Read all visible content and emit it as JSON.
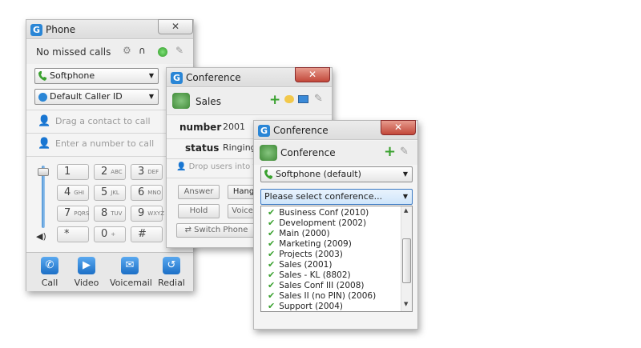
{
  "phone": {
    "title": "Phone",
    "close": "✕",
    "status": "No missed calls",
    "device": "Softphone",
    "caller_id": "Default Caller ID",
    "contact_placeholder": "Drag a contact to call",
    "number_placeholder": "Enter a number to call",
    "keys": [
      {
        "d": "1",
        "s": ""
      },
      {
        "d": "2",
        "s": "ABC"
      },
      {
        "d": "3",
        "s": "DEF"
      },
      {
        "d": "4",
        "s": "GHI"
      },
      {
        "d": "5",
        "s": "JKL"
      },
      {
        "d": "6",
        "s": "MNO"
      },
      {
        "d": "7",
        "s": "PQRS"
      },
      {
        "d": "8",
        "s": "TUV"
      },
      {
        "d": "9",
        "s": "WXYZ"
      },
      {
        "d": "*",
        "s": ""
      },
      {
        "d": "0",
        "s": "+"
      },
      {
        "d": "#",
        "s": ""
      }
    ],
    "volume": 0.85,
    "toolbar": [
      "Call",
      "Video",
      "Voicemail",
      "Redial"
    ]
  },
  "conf1": {
    "title": "Conference",
    "close": "✕",
    "name": "Sales",
    "number_label": "number",
    "number_value": "2001",
    "status_label": "status",
    "status_value": "Ringing (",
    "drop_placeholder": "Drop users into th",
    "buttons": {
      "answer": "Answer",
      "hangup": "Hang",
      "hold": "Hold",
      "voicemail": "Voicel",
      "switch": "Switch Phone"
    }
  },
  "conf2": {
    "title": "Conference",
    "close": "✕",
    "header": "Conference",
    "device": "Softphone (default)",
    "select_label": "Please select conference...",
    "options": [
      "Business Conf (2010)",
      "Development (2002)",
      "Main (2000)",
      "Marketing (2009)",
      "Projects (2003)",
      "Sales (2001)",
      "Sales - KL (8802)",
      "Sales Conf III (2008)",
      "Sales II (no PIN) (2006)",
      "Support (2004)"
    ]
  },
  "colors": {
    "accent": "#2a86d6",
    "green": "#3aa12f",
    "close_red": "#c2483a"
  }
}
